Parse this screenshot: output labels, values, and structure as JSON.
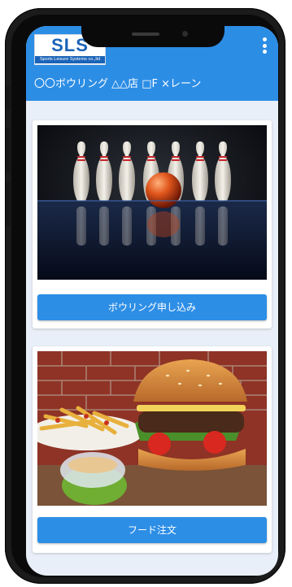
{
  "logo": {
    "text": "SLS",
    "subtitle": "Sports Leisure Systems co.,ltd"
  },
  "header": {
    "title": "〇〇ボウリング △△店 □F ×レーン",
    "menu_icon": "kebab-menu-icon"
  },
  "cards": [
    {
      "image": "bowling-pins-photo",
      "button_label": "ボウリング申し込み"
    },
    {
      "image": "hamburger-fries-photo",
      "button_label": "フード注文"
    }
  ],
  "colors": {
    "header": "#2c8de5",
    "button": "#2d8ee6",
    "background": "#e8eff8"
  }
}
